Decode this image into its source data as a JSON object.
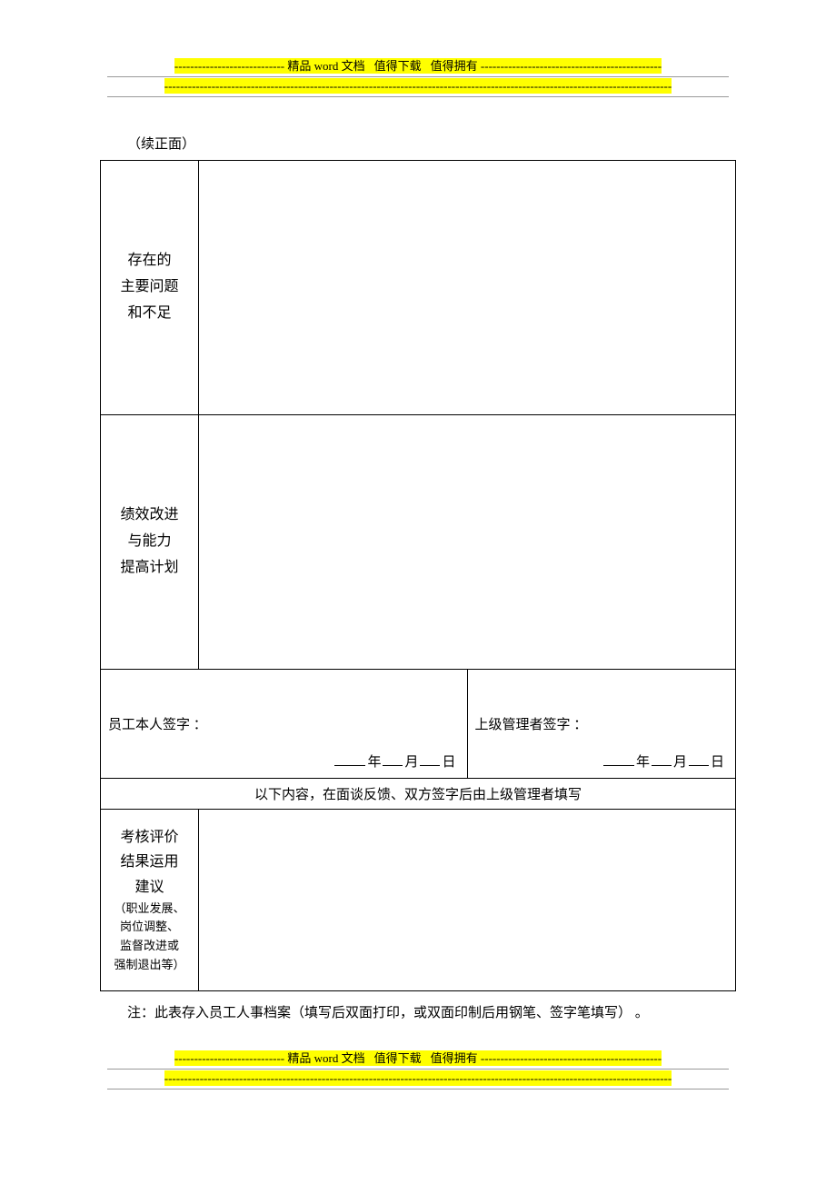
{
  "banner": {
    "dash_left": "----------------------------",
    "text_main": "精品",
    "text_word": "word",
    "text_doc": "文档",
    "text_worth_dl": "值得下载",
    "text_worth_own": "值得拥有",
    "dash_right": "----------------------------------------------",
    "line2_dashes": "---------------------------------------------------------------------------------------------------------------------------------"
  },
  "continued": "（续正面）",
  "row1_label": "存在的\n主要问题\n和不足",
  "row2_label": "绩效改进\n与能力\n提高计划",
  "sig_left": "员工本人签字 ：",
  "sig_right": "上级管理者签字 ：",
  "date_units": {
    "year": "年",
    "month": "月",
    "day": "日"
  },
  "section_header": "以下内容，在面谈反馈、双方签字后由上级管理者填写",
  "row3": {
    "main": "考核评价\n结果运用\n建议",
    "note": "（职业发展、\n岗位调整、\n监督改进或\n强制退出等）"
  },
  "footnote": "注：此表存入员工人事档案（填写后双面打印，或双面印制后用钢笔、签字笔填写） 。"
}
